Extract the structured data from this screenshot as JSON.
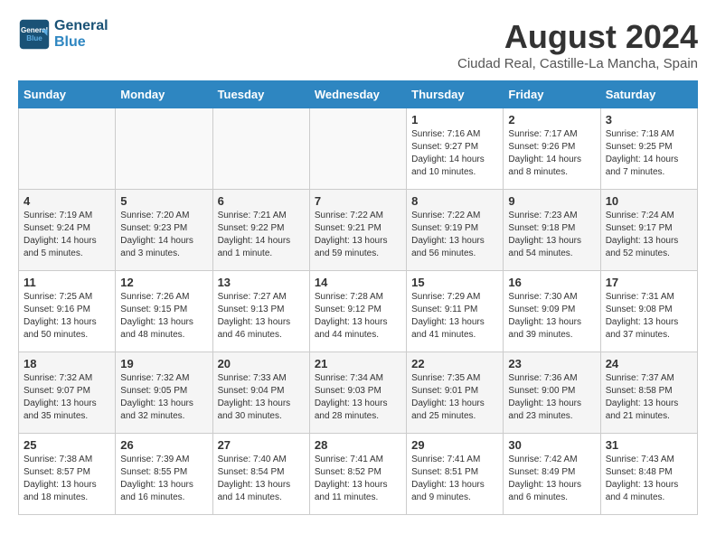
{
  "header": {
    "logo_line1": "General",
    "logo_line2": "Blue",
    "month": "August 2024",
    "location": "Ciudad Real, Castille-La Mancha, Spain"
  },
  "weekdays": [
    "Sunday",
    "Monday",
    "Tuesday",
    "Wednesday",
    "Thursday",
    "Friday",
    "Saturday"
  ],
  "weeks": [
    [
      {
        "day": "",
        "content": ""
      },
      {
        "day": "",
        "content": ""
      },
      {
        "day": "",
        "content": ""
      },
      {
        "day": "",
        "content": ""
      },
      {
        "day": "1",
        "content": "Sunrise: 7:16 AM\nSunset: 9:27 PM\nDaylight: 14 hours\nand 10 minutes."
      },
      {
        "day": "2",
        "content": "Sunrise: 7:17 AM\nSunset: 9:26 PM\nDaylight: 14 hours\nand 8 minutes."
      },
      {
        "day": "3",
        "content": "Sunrise: 7:18 AM\nSunset: 9:25 PM\nDaylight: 14 hours\nand 7 minutes."
      }
    ],
    [
      {
        "day": "4",
        "content": "Sunrise: 7:19 AM\nSunset: 9:24 PM\nDaylight: 14 hours\nand 5 minutes."
      },
      {
        "day": "5",
        "content": "Sunrise: 7:20 AM\nSunset: 9:23 PM\nDaylight: 14 hours\nand 3 minutes."
      },
      {
        "day": "6",
        "content": "Sunrise: 7:21 AM\nSunset: 9:22 PM\nDaylight: 14 hours\nand 1 minute."
      },
      {
        "day": "7",
        "content": "Sunrise: 7:22 AM\nSunset: 9:21 PM\nDaylight: 13 hours\nand 59 minutes."
      },
      {
        "day": "8",
        "content": "Sunrise: 7:22 AM\nSunset: 9:19 PM\nDaylight: 13 hours\nand 56 minutes."
      },
      {
        "day": "9",
        "content": "Sunrise: 7:23 AM\nSunset: 9:18 PM\nDaylight: 13 hours\nand 54 minutes."
      },
      {
        "day": "10",
        "content": "Sunrise: 7:24 AM\nSunset: 9:17 PM\nDaylight: 13 hours\nand 52 minutes."
      }
    ],
    [
      {
        "day": "11",
        "content": "Sunrise: 7:25 AM\nSunset: 9:16 PM\nDaylight: 13 hours\nand 50 minutes."
      },
      {
        "day": "12",
        "content": "Sunrise: 7:26 AM\nSunset: 9:15 PM\nDaylight: 13 hours\nand 48 minutes."
      },
      {
        "day": "13",
        "content": "Sunrise: 7:27 AM\nSunset: 9:13 PM\nDaylight: 13 hours\nand 46 minutes."
      },
      {
        "day": "14",
        "content": "Sunrise: 7:28 AM\nSunset: 9:12 PM\nDaylight: 13 hours\nand 44 minutes."
      },
      {
        "day": "15",
        "content": "Sunrise: 7:29 AM\nSunset: 9:11 PM\nDaylight: 13 hours\nand 41 minutes."
      },
      {
        "day": "16",
        "content": "Sunrise: 7:30 AM\nSunset: 9:09 PM\nDaylight: 13 hours\nand 39 minutes."
      },
      {
        "day": "17",
        "content": "Sunrise: 7:31 AM\nSunset: 9:08 PM\nDaylight: 13 hours\nand 37 minutes."
      }
    ],
    [
      {
        "day": "18",
        "content": "Sunrise: 7:32 AM\nSunset: 9:07 PM\nDaylight: 13 hours\nand 35 minutes."
      },
      {
        "day": "19",
        "content": "Sunrise: 7:32 AM\nSunset: 9:05 PM\nDaylight: 13 hours\nand 32 minutes."
      },
      {
        "day": "20",
        "content": "Sunrise: 7:33 AM\nSunset: 9:04 PM\nDaylight: 13 hours\nand 30 minutes."
      },
      {
        "day": "21",
        "content": "Sunrise: 7:34 AM\nSunset: 9:03 PM\nDaylight: 13 hours\nand 28 minutes."
      },
      {
        "day": "22",
        "content": "Sunrise: 7:35 AM\nSunset: 9:01 PM\nDaylight: 13 hours\nand 25 minutes."
      },
      {
        "day": "23",
        "content": "Sunrise: 7:36 AM\nSunset: 9:00 PM\nDaylight: 13 hours\nand 23 minutes."
      },
      {
        "day": "24",
        "content": "Sunrise: 7:37 AM\nSunset: 8:58 PM\nDaylight: 13 hours\nand 21 minutes."
      }
    ],
    [
      {
        "day": "25",
        "content": "Sunrise: 7:38 AM\nSunset: 8:57 PM\nDaylight: 13 hours\nand 18 minutes."
      },
      {
        "day": "26",
        "content": "Sunrise: 7:39 AM\nSunset: 8:55 PM\nDaylight: 13 hours\nand 16 minutes."
      },
      {
        "day": "27",
        "content": "Sunrise: 7:40 AM\nSunset: 8:54 PM\nDaylight: 13 hours\nand 14 minutes."
      },
      {
        "day": "28",
        "content": "Sunrise: 7:41 AM\nSunset: 8:52 PM\nDaylight: 13 hours\nand 11 minutes."
      },
      {
        "day": "29",
        "content": "Sunrise: 7:41 AM\nSunset: 8:51 PM\nDaylight: 13 hours\nand 9 minutes."
      },
      {
        "day": "30",
        "content": "Sunrise: 7:42 AM\nSunset: 8:49 PM\nDaylight: 13 hours\nand 6 minutes."
      },
      {
        "day": "31",
        "content": "Sunrise: 7:43 AM\nSunset: 8:48 PM\nDaylight: 13 hours\nand 4 minutes."
      }
    ]
  ]
}
